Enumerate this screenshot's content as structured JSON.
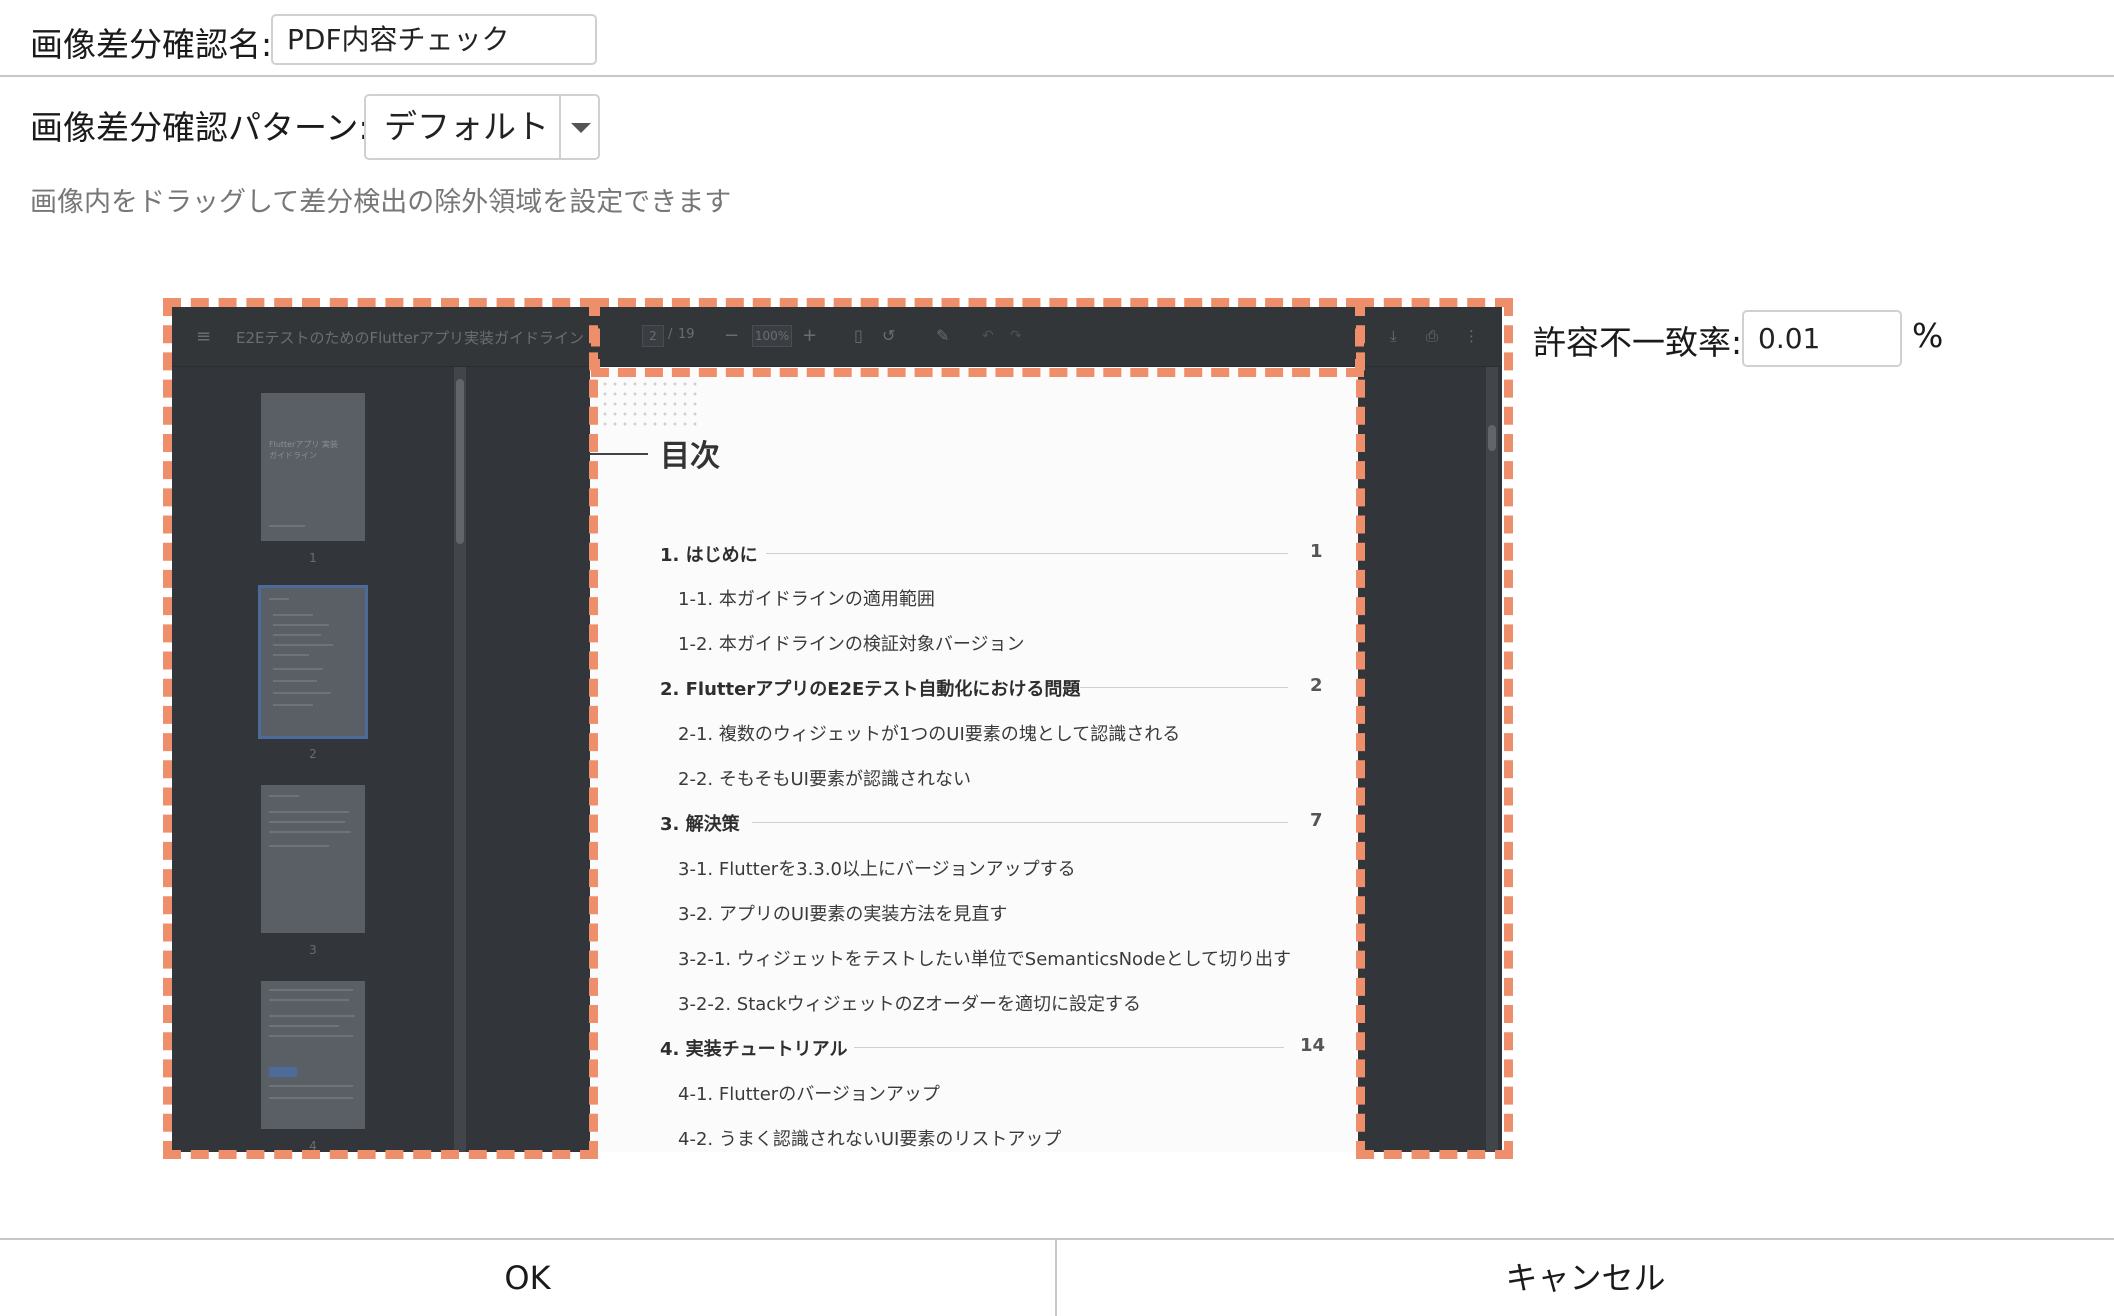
{
  "form": {
    "name_label": "画像差分確認名:",
    "name_value": "PDF内容チェック",
    "pattern_label": "画像差分確認パターン:",
    "pattern_value": "デフォルト",
    "hint": "画像内をドラッグして差分検出の除外領域を設定できます",
    "tolerance_label": "許容不一致率:",
    "tolerance_value": "0.01",
    "tolerance_unit": "%"
  },
  "viewer": {
    "doc_title": "E2EテストのためのFlutterアプリ実装ガイドライン",
    "page_current": "2",
    "page_sep": "/",
    "page_total": "19",
    "zoom": "100%",
    "thumbnails": [
      {
        "num": "1",
        "title": "Flutterアプリ 実装ガイドライン"
      },
      {
        "num": "2"
      },
      {
        "num": "3"
      },
      {
        "num": "4"
      }
    ],
    "page_heading": "目次",
    "toc": [
      {
        "text": "1. はじめに",
        "page": "1",
        "bold": true
      },
      {
        "text": "1-1. 本ガイドラインの適用範囲"
      },
      {
        "text": "1-2. 本ガイドラインの検証対象バージョン"
      },
      {
        "text": "2. FlutterアプリのE2Eテスト自動化における問題",
        "page": "2",
        "bold": true
      },
      {
        "text": "2-1. 複数のウィジェットが1つのUI要素の塊として認識される"
      },
      {
        "text": "2-2. そもそもUI要素が認識されない"
      },
      {
        "text": "3. 解決策",
        "page": "7",
        "bold": true
      },
      {
        "text": "3-1. Flutterを3.3.0以上にバージョンアップする"
      },
      {
        "text": "3-2. アプリのUI要素の実装方法を見直す"
      },
      {
        "text": "3-2-1. ウィジェットをテストしたい単位でSemanticsNodeとして切り出す"
      },
      {
        "text": "3-2-2. StackウィジェットのZオーダーを適切に設定する"
      },
      {
        "text": "4. 実装チュートリアル",
        "page": "14",
        "bold": true
      },
      {
        "text": "4-1. Flutterのバージョンアップ"
      },
      {
        "text": "4-2. うまく認識されないUI要素のリストアップ"
      }
    ]
  },
  "footer": {
    "ok_label": "OK",
    "cancel_label": "キャンセル"
  },
  "colors": {
    "exclusion_border": "#ef8e6a",
    "viewer_bg": "#32363b"
  }
}
